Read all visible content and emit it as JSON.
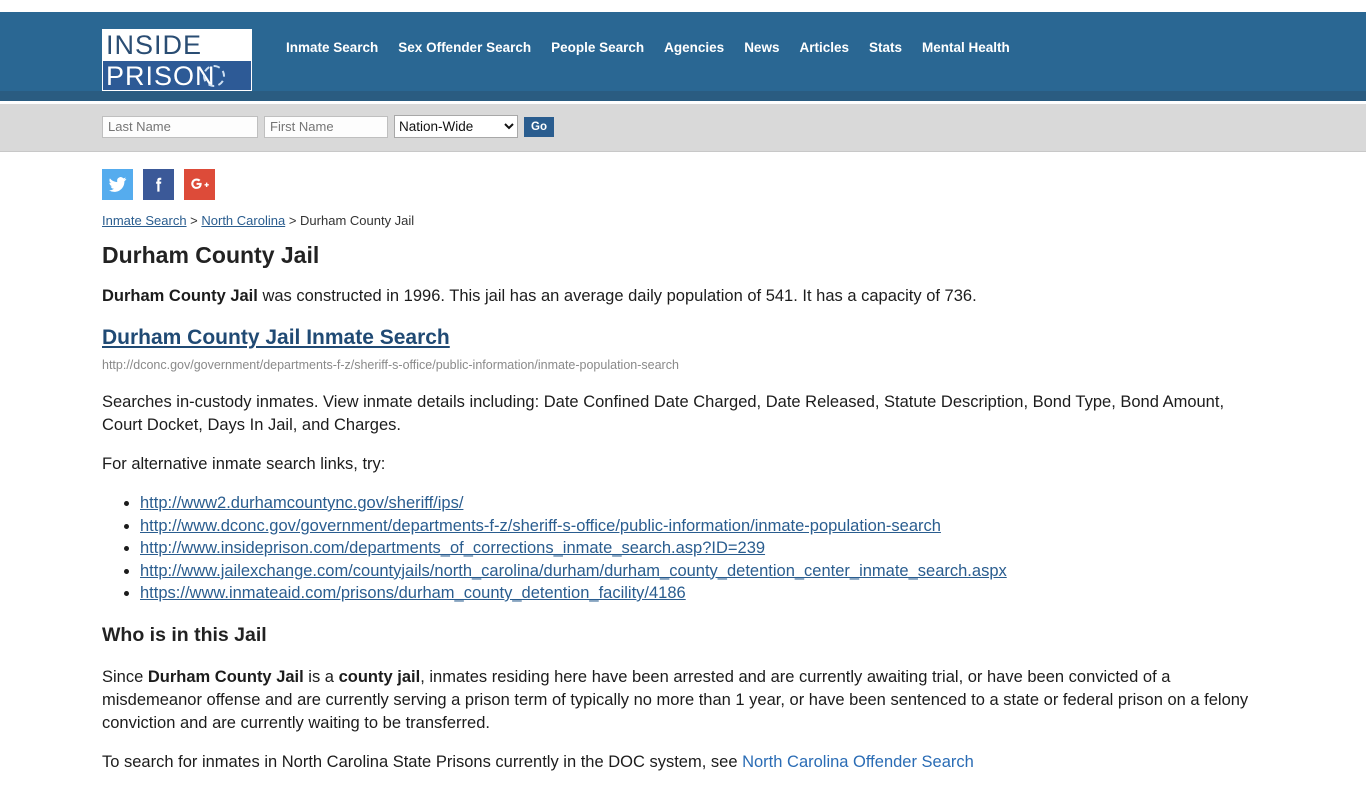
{
  "header": {
    "logo": {
      "line1": "INSIDE",
      "line2": "PRISON"
    },
    "nav": [
      {
        "label": "Inmate Search"
      },
      {
        "label": "Sex Offender Search"
      },
      {
        "label": "People Search"
      },
      {
        "label": "Agencies"
      },
      {
        "label": "News"
      },
      {
        "label": "Articles"
      },
      {
        "label": "Stats"
      },
      {
        "label": "Mental Health"
      }
    ],
    "accent_color": "#2a6793"
  },
  "search": {
    "last_name_placeholder": "Last Name",
    "last_name_value": "",
    "first_name_placeholder": "First Name",
    "first_name_value": "",
    "scope_selected": "Nation-Wide",
    "scope_options": [
      "Nation-Wide"
    ],
    "go_label": "Go"
  },
  "social": [
    {
      "name": "twitter-icon",
      "color": "#55acee"
    },
    {
      "name": "facebook-icon",
      "color": "#3b5998"
    },
    {
      "name": "googleplus-icon",
      "color": "#dd4b39"
    }
  ],
  "breadcrumb": {
    "item1": "Inmate Search",
    "sep1": " > ",
    "item2": "North Carolina",
    "sep2": " > ",
    "item3": "Durham County Jail"
  },
  "main": {
    "page_title": "Durham County Jail",
    "intro": {
      "facility_bold": "Durham County Jail",
      "rest": " was constructed in 1996. This jail has an average daily population of 541. It has a capacity of 736."
    },
    "facts": {
      "constructed_year": "1996",
      "average_daily_population": "541",
      "capacity": "736"
    },
    "primary_link": {
      "label": "Durham County Jail Inmate Search",
      "url": "http://dconc.gov/government/departments-f-z/sheriff-s-office/public-information/inmate-population-search"
    },
    "description": "Searches in-custody inmates. View inmate details including: Date Confined Date Charged, Date Released, Statute Description, Bond Type, Bond Amount, Court Docket, Days In Jail, and Charges.",
    "alt_intro": "For alternative inmate search links, try:",
    "alt_links": [
      "http://www2.durhamcountync.gov/sheriff/ips/",
      "http://www.dconc.gov/government/departments-f-z/sheriff-s-office/public-information/inmate-population-search",
      "http://www.insideprison.com/departments_of_corrections_inmate_search.asp?ID=239",
      "http://www.jailexchange.com/countyjails/north_carolina/durham/durham_county_detention_center_inmate_search.aspx",
      "https://www.inmateaid.com/prisons/durham_county_detention_facility/4186"
    ],
    "who_heading": "Who is in this Jail",
    "who_paragraph": {
      "part1": "Since ",
      "bold1": "Durham County Jail",
      "part2": " is a ",
      "bold2": "county jail",
      "part3": ", inmates residing here have been arrested and are currently awaiting trial, or have been convicted of a misdemeanor offense and are currently serving a prison term of typically no more than 1 year, or have been sentenced to a state or federal prison on a felony conviction and are currently waiting to be transferred."
    },
    "doc_paragraph": {
      "part1": "To search for inmates in North Carolina State Prisons currently in the DOC system, see ",
      "link": "North Carolina Offender Search"
    }
  }
}
